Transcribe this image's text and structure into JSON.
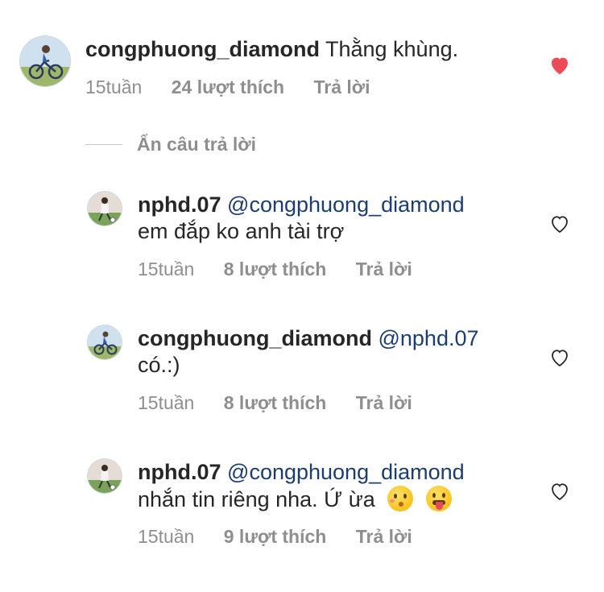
{
  "comments": [
    {
      "username": "congphuong_diamond",
      "text": "Thằng khùng.",
      "time": "15tuần",
      "likes": "24 lượt thích",
      "reply": "Trả lời",
      "liked": true
    }
  ],
  "hide_replies_label": "Ẩn câu trả lời",
  "replies": [
    {
      "username": "nphd.07",
      "mention": "@congphuong_diamond",
      "text": "em đắp ko anh tài trợ",
      "time": "15tuần",
      "likes": "8 lượt thích",
      "reply": "Trả lời",
      "liked": false
    },
    {
      "username": "congphuong_diamond",
      "mention": "@nphd.07",
      "text": "có.:)",
      "time": "15tuần",
      "likes": "8 lượt thích",
      "reply": "Trả lời",
      "liked": false
    },
    {
      "username": "nphd.07",
      "mention": "@congphuong_diamond",
      "text": "nhắn tin riêng nha. Ứ ừa",
      "emojis": [
        "kissing-face",
        "face-with-tongue"
      ],
      "time": "15tuần",
      "likes": "9 lượt thích",
      "reply": "Trả lời",
      "liked": false
    }
  ],
  "colors": {
    "liked_heart": "#ed4956",
    "mention": "#1b3d73",
    "meta": "#8e8e8e"
  }
}
